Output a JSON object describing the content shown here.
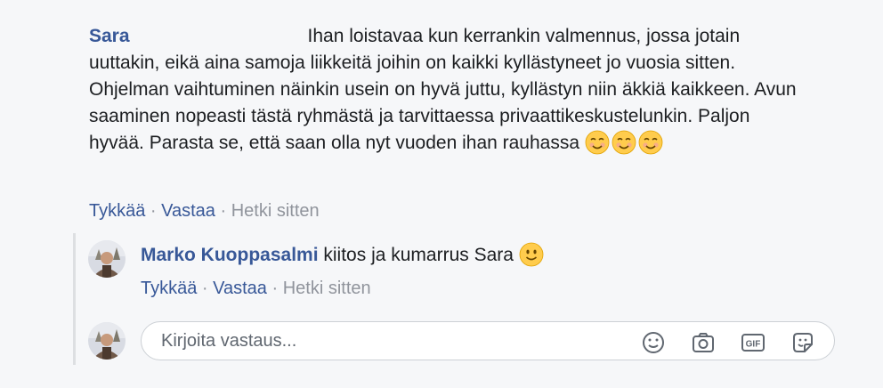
{
  "comment": {
    "author": "Sara",
    "text": "Ihan loistavaa kun kerrankin valmennus, jossa jotain uuttakin, eikä aina samoja liikkeitä joihin on kaikki kyllästyneet jo vuosia sitten. Ohjelman vaihtuminen näinkin usein on hyvä juttu, kyllästyn niin äkkiä kaikkeen. Avun saaminen nopeasti tästä ryhmästä ja tarvittaessa privaattikeskustelunkin. Paljon hyvää. Parasta se, että saan olla nyt vuoden ihan rauhassa",
    "emojis": [
      "smiling-face-icon",
      "smiling-face-icon",
      "smiling-face-icon"
    ],
    "actions": {
      "like": "Tykkää",
      "reply": "Vastaa",
      "separator": " · ",
      "time": "Hetki sitten"
    }
  },
  "reply": {
    "author": "Marko Kuoppasalmi",
    "text": "kiitos ja kumarrus Sara",
    "emoji": "slightly-smiling-face-icon",
    "actions": {
      "like": "Tykkää",
      "reply": "Vastaa",
      "separator": " · ",
      "time": "Hetki sitten"
    }
  },
  "composer": {
    "placeholder": "Kirjoita vastaus...",
    "icons": [
      "emoji-icon",
      "camera-icon",
      "gif-icon",
      "sticker-icon"
    ]
  },
  "colors": {
    "link": "#385898",
    "muted": "#90949c",
    "text": "#1c1e21",
    "emoji": "#ffcc4d",
    "background": "#f6f7f9"
  }
}
